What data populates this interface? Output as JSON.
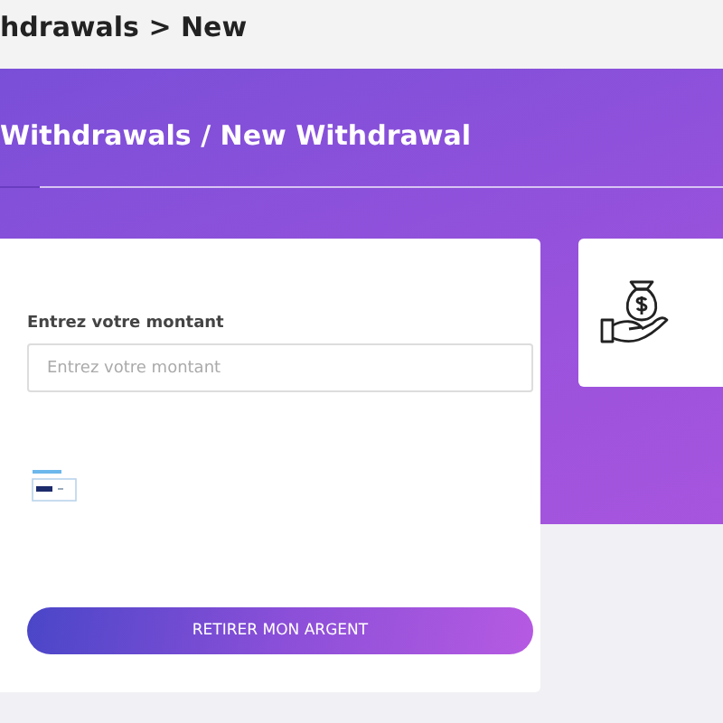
{
  "breadcrumb": "hdrawals > New",
  "banner": {
    "title": "Withdrawals / New Withdrawal"
  },
  "form": {
    "label": "Entrez votre montant",
    "placeholder": "Entrez votre montant",
    "button": "RETIRER MON ARGENT"
  }
}
